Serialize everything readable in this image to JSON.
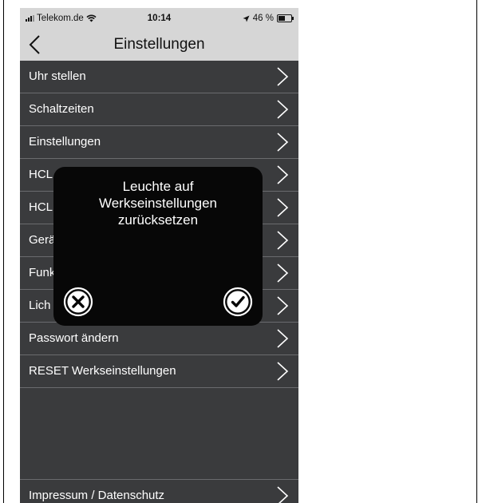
{
  "status_bar": {
    "carrier": "Telekom.de",
    "time": "10:14",
    "battery": "46 %"
  },
  "nav": {
    "title": "Einstellungen",
    "back_icon": "chevron-left-icon"
  },
  "menu_items": [
    {
      "label": "Uhr stellen"
    },
    {
      "label": "Schaltzeiten"
    },
    {
      "label": "Einstellungen"
    },
    {
      "label": "HCL"
    },
    {
      "label": "HCL"
    },
    {
      "label": "Gerä"
    },
    {
      "label": "Funk"
    },
    {
      "label": "Lich"
    },
    {
      "label": "Passwort ändern"
    },
    {
      "label": "RESET Werkseinstellungen"
    }
  ],
  "footer_item": {
    "label": "Impressum / Datenschutz"
  },
  "dialog": {
    "message": "Leuchte auf\nWerkseinstellungen\nzurücksetzen",
    "cancel_icon": "close-circle-icon",
    "confirm_icon": "checkmark-circle-icon"
  },
  "colors": {
    "background": "#3a3b3d",
    "bar": "#d6d6d6",
    "dialog": "#070707",
    "text": "#ffffff"
  }
}
